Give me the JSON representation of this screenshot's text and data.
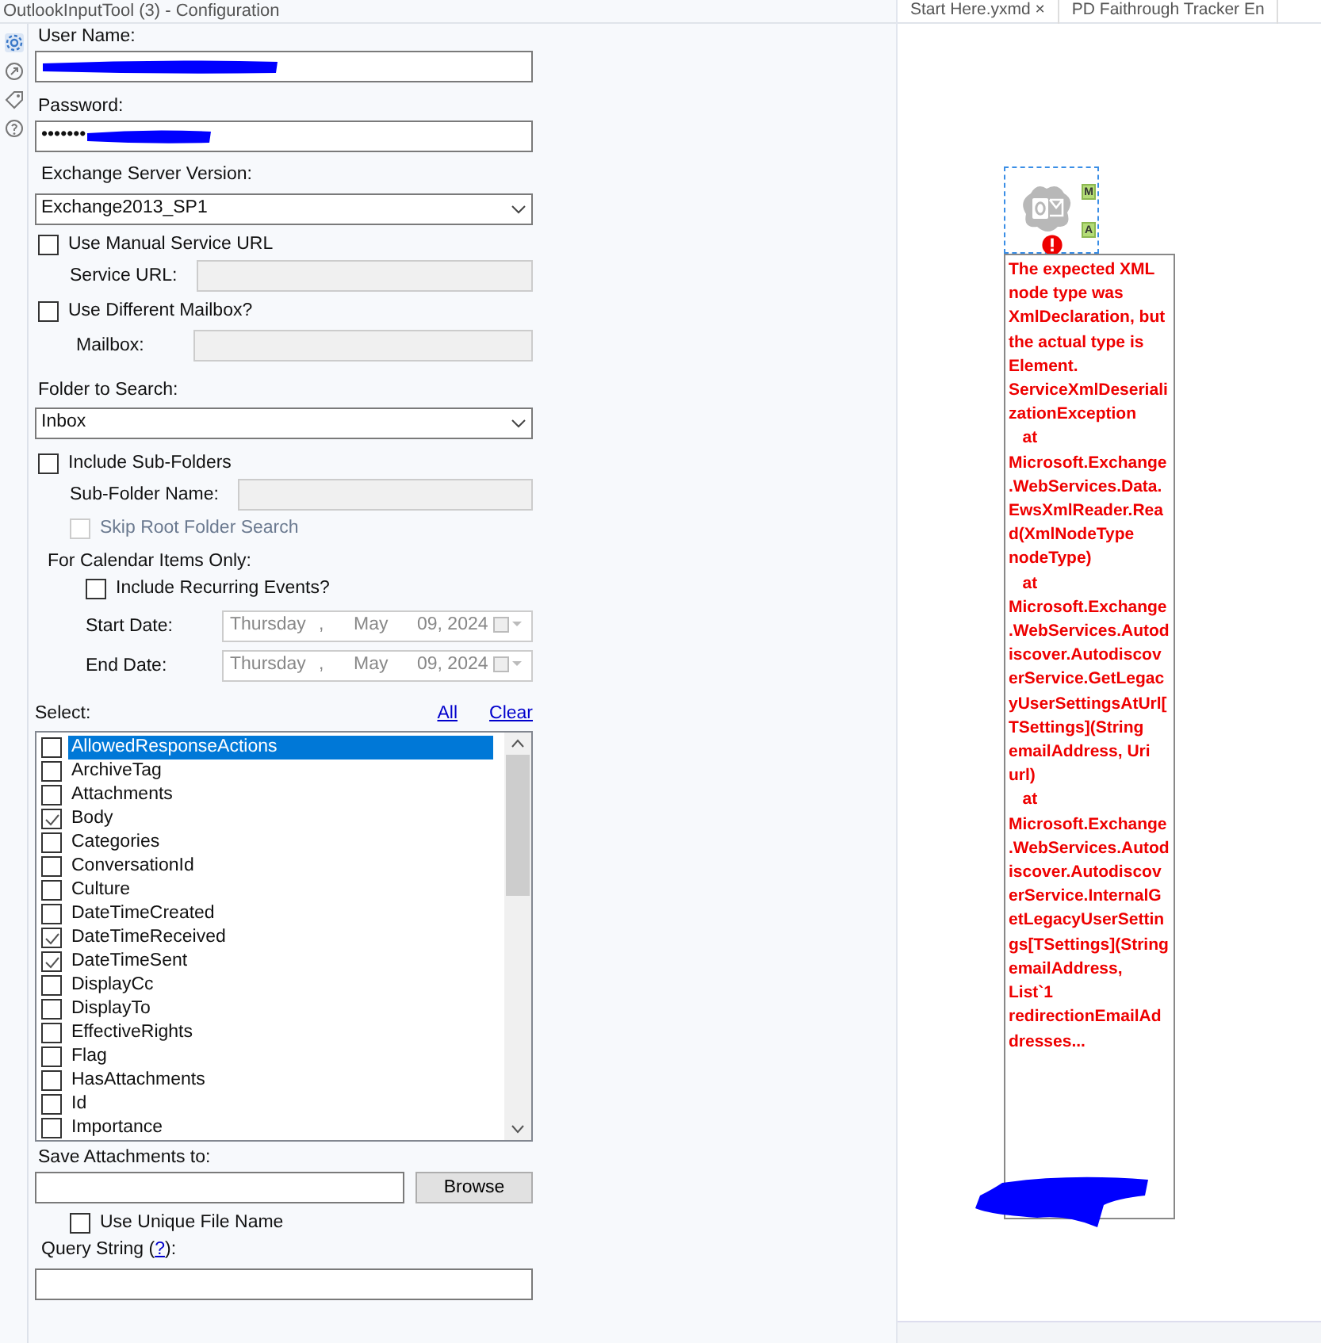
{
  "header": {
    "title": "OutlookInputTool (3) - Configuration"
  },
  "workflow_tabs": [
    {
      "label": "Start Here.yxmd",
      "close": "×"
    },
    {
      "label": "PD Faithrough Tracker En"
    }
  ],
  "side_tabs": [
    {
      "kind": "gear",
      "selected": true
    },
    {
      "kind": "link",
      "selected": false
    },
    {
      "kind": "tag",
      "selected": false
    },
    {
      "kind": "help",
      "selected": false
    }
  ],
  "form": {
    "user_name": {
      "label": "User Name:",
      "redacted": true
    },
    "password": {
      "label": "Password:",
      "value": "•••••••",
      "redacted": true
    },
    "exchange_version": {
      "label": "Exchange Server Version:",
      "value": "Exchange2013_SP1"
    },
    "use_manual_url": {
      "label": "Use Manual Service URL",
      "checked": false
    },
    "service_url": {
      "label": "Service URL:",
      "disabled": true
    },
    "use_different_mailbox": {
      "label": "Use Different Mailbox?",
      "checked": false
    },
    "mailbox": {
      "label": "Mailbox:",
      "disabled": true
    },
    "folder": {
      "label": "Folder to Search:",
      "value": "Inbox"
    },
    "include_subfolders": {
      "label": "Include Sub-Folders",
      "checked": false
    },
    "subfolder_name": {
      "label": "Sub-Folder Name:",
      "disabled": true
    },
    "skip_root": {
      "label": "Skip Root Folder Search",
      "checked": false,
      "disabled": true
    },
    "calendar_heading": "For Calendar Items Only:",
    "include_recurring": {
      "label": "Include Recurring Events?",
      "checked": false
    },
    "start_date": {
      "label": "Start Date:",
      "weekday": "Thursday",
      "sep": ",",
      "month": "May",
      "day_year": "09, 2024",
      "disabled": true
    },
    "end_date": {
      "label": "End Date:",
      "weekday": "Thursday",
      "sep": ",",
      "month": "May",
      "day_year": "09, 2024",
      "disabled": true
    },
    "select_label": "Select:",
    "all_link": "All",
    "clear_link": "Clear",
    "fields": [
      {
        "label": "AllowedResponseActions",
        "checked": false,
        "selected": true
      },
      {
        "label": "ArchiveTag",
        "checked": false,
        "selected": false
      },
      {
        "label": "Attachments",
        "checked": false,
        "selected": false
      },
      {
        "label": "Body",
        "checked": true,
        "selected": false
      },
      {
        "label": "Categories",
        "checked": false,
        "selected": false
      },
      {
        "label": "ConversationId",
        "checked": false,
        "selected": false
      },
      {
        "label": "Culture",
        "checked": false,
        "selected": false
      },
      {
        "label": "DateTimeCreated",
        "checked": false,
        "selected": false
      },
      {
        "label": "DateTimeReceived",
        "checked": true,
        "selected": false
      },
      {
        "label": "DateTimeSent",
        "checked": true,
        "selected": false
      },
      {
        "label": "DisplayCc",
        "checked": false,
        "selected": false
      },
      {
        "label": "DisplayTo",
        "checked": false,
        "selected": false
      },
      {
        "label": "EffectiveRights",
        "checked": false,
        "selected": false
      },
      {
        "label": "Flag",
        "checked": false,
        "selected": false
      },
      {
        "label": "HasAttachments",
        "checked": false,
        "selected": false
      },
      {
        "label": "Id",
        "checked": false,
        "selected": false
      },
      {
        "label": "Importance",
        "checked": false,
        "selected": false
      }
    ],
    "save_attachments": {
      "label": "Save Attachments to:",
      "button": "Browse"
    },
    "unique_name": {
      "label": "Use Unique File Name",
      "checked": false
    },
    "query_string": {
      "label": "Query String (",
      "link": "?",
      "label_end": "):"
    }
  },
  "canvas": {
    "node": {
      "badges": [
        "M",
        "A"
      ],
      "error": true,
      "message": "The expected XML node type was XmlDeclaration, but the actual type is Element. ServiceXmlDeserializationException\n   at Microsoft.Exchange.WebServices.Data.EwsXmlReader.Read(XmlNodeType nodeType)\n   at Microsoft.Exchange.WebServices.Autodiscover.AutodiscoverService.GetLegacyUserSettingsAtUrl[TSettings](String emailAddress, Uri url)\n   at Microsoft.Exchange.WebServices.Autodiscover.AutodiscoverService.InternalGetLegacyUserSettings[TSettings](String emailAddress, List`1 redirectionEmailAddresses...",
      "redacted": true
    }
  }
}
